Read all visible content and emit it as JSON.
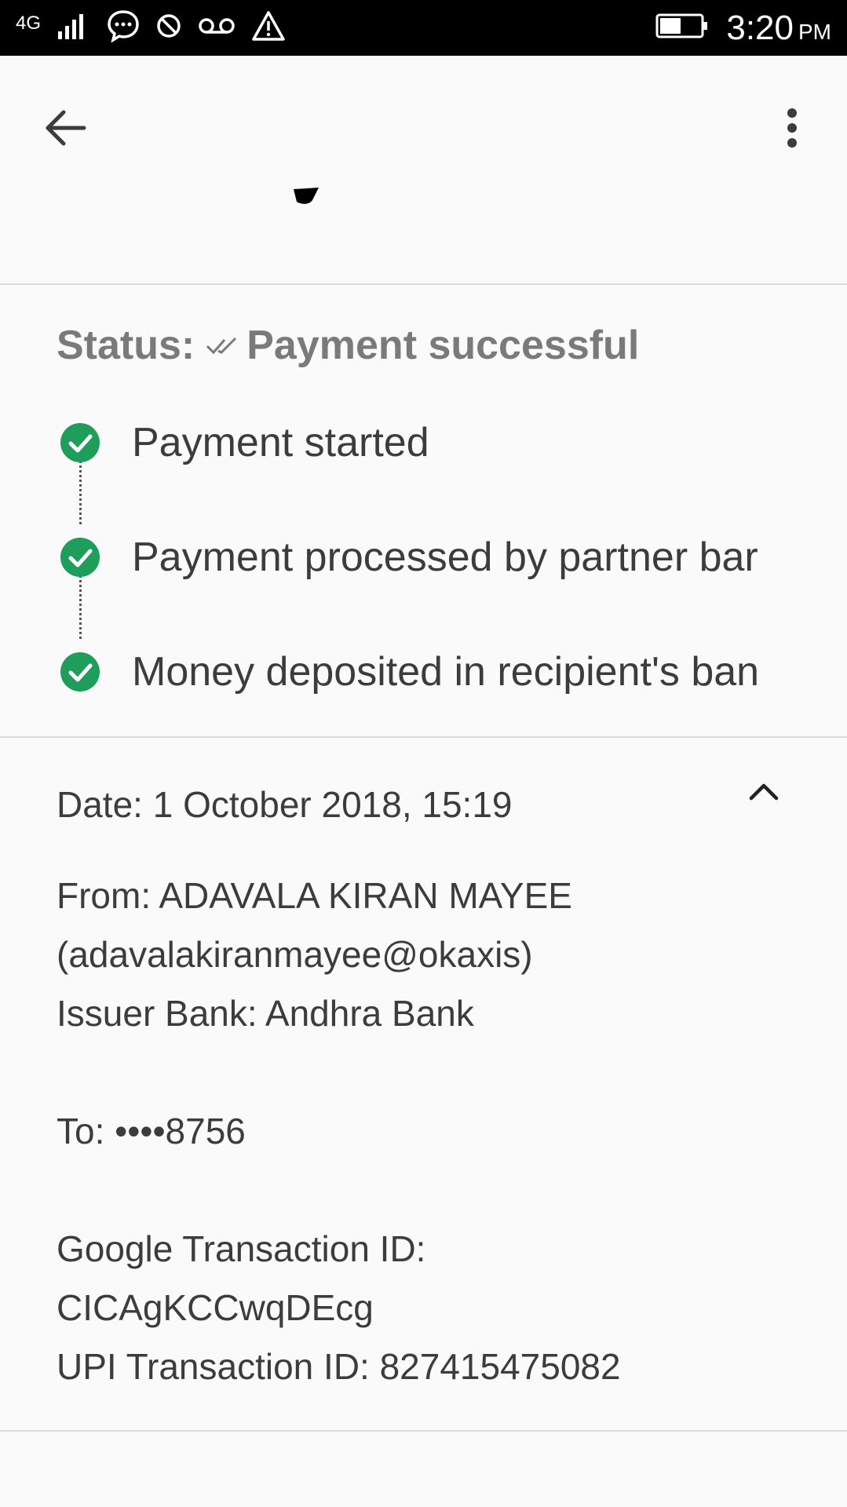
{
  "status_bar": {
    "network": "4G",
    "time": "3:20",
    "ampm": "PM"
  },
  "transaction": {
    "status_prefix": "Status:",
    "status_value": "Payment successful",
    "steps": [
      {
        "label": "Payment started"
      },
      {
        "label": "Payment processed by partner bar"
      },
      {
        "label": "Money deposited in recipient's ban"
      }
    ],
    "date": "Date: 1 October 2018, 15:19",
    "from_line1": "From: ADAVALA KIRAN MAYEE",
    "from_line2": "(adavalakiranmayee@okaxis)",
    "issuer_bank": "Issuer Bank: Andhra Bank",
    "to": "To: ••••8756",
    "google_txn_label": "Google Transaction ID:",
    "google_txn_id": "CICAgKCCwqDEcg",
    "upi_txn": "UPI Transaction ID: 827415475082"
  },
  "colors": {
    "success_green": "#1e9e5a",
    "status_gray": "#7a7a7a",
    "text": "#3c3c3c",
    "divider": "#dcdcdc"
  },
  "icons": {
    "back": "arrow-left-icon",
    "more": "more-vert-icon",
    "collapse": "chevron-up-icon",
    "step": "check-circle-icon"
  }
}
